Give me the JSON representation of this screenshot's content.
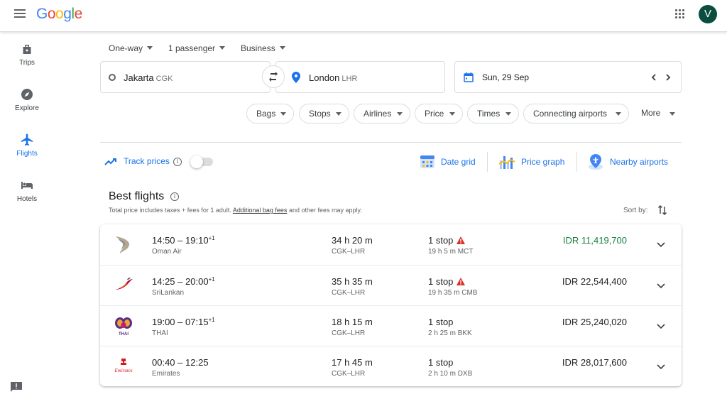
{
  "header": {
    "logo_letters": [
      {
        "ch": "G",
        "color": "#4285F4"
      },
      {
        "ch": "o",
        "color": "#EA4335"
      },
      {
        "ch": "o",
        "color": "#FBBC05"
      },
      {
        "ch": "g",
        "color": "#4285F4"
      },
      {
        "ch": "l",
        "color": "#34A853"
      },
      {
        "ch": "e",
        "color": "#EA4335"
      }
    ],
    "avatar_letter": "V",
    "avatar_color": "#0b4d3f"
  },
  "sidebar": {
    "items": [
      {
        "label": "Trips",
        "icon": "trips-icon",
        "active": false
      },
      {
        "label": "Explore",
        "icon": "explore-icon",
        "active": false
      },
      {
        "label": "Flights",
        "icon": "flights-icon",
        "active": true
      },
      {
        "label": "Hotels",
        "icon": "hotels-icon",
        "active": false
      }
    ]
  },
  "search": {
    "trip_type": "One-way",
    "passengers": "1 passenger",
    "cabin": "Business",
    "origin": {
      "city": "Jakarta",
      "code": "CGK"
    },
    "destination": {
      "city": "London",
      "code": "LHR"
    },
    "date": "Sun, 29 Sep"
  },
  "filters": [
    "Bags",
    "Stops",
    "Airlines",
    "Price",
    "Times",
    "Connecting airports"
  ],
  "more_filters_label": "More",
  "tools": {
    "track_prices": "Track prices",
    "track_enabled": false,
    "date_grid": "Date grid",
    "price_graph": "Price graph",
    "nearby_airports": "Nearby airports"
  },
  "results": {
    "title": "Best flights",
    "note_prefix": "Total price includes taxes + fees for 1 adult.",
    "note_link": "Additional bag fees",
    "note_suffix": "and other fees may apply.",
    "sort_label": "Sort by:",
    "flights": [
      {
        "depart": "14:50",
        "arrive": "19:10",
        "plus_day": "+1",
        "airline": "Oman Air",
        "duration": "34 h 20 m",
        "route": "CGK–LHR",
        "stops": "1 stop",
        "warning": true,
        "layover": "19 h 5 m MCT",
        "price": "IDR 11,419,700",
        "cheap": true,
        "logo": "oman-air-logo"
      },
      {
        "depart": "14:25",
        "arrive": "20:00",
        "plus_day": "+1",
        "airline": "SriLankan",
        "duration": "35 h 35 m",
        "route": "CGK–LHR",
        "stops": "1 stop",
        "warning": true,
        "layover": "19 h 35 m CMB",
        "price": "IDR 22,544,400",
        "cheap": false,
        "logo": "srilankan-logo"
      },
      {
        "depart": "19:00",
        "arrive": "07:15",
        "plus_day": "+1",
        "airline": "THAI",
        "duration": "18 h 15 m",
        "route": "CGK–LHR",
        "stops": "1 stop",
        "warning": false,
        "layover": "2 h 25 m BKK",
        "price": "IDR 25,240,020",
        "cheap": false,
        "logo": "thai-logo"
      },
      {
        "depart": "00:40",
        "arrive": "12:25",
        "plus_day": "",
        "airline": "Emirates",
        "duration": "17 h 45 m",
        "route": "CGK–LHR",
        "stops": "1 stop",
        "warning": false,
        "layover": "2 h 10 m DXB",
        "price": "IDR 28,017,600",
        "cheap": false,
        "logo": "emirates-logo"
      }
    ]
  },
  "colors": {
    "accent": "#1a73e8",
    "cheap_price": "#188038",
    "warning": "#d93025"
  }
}
